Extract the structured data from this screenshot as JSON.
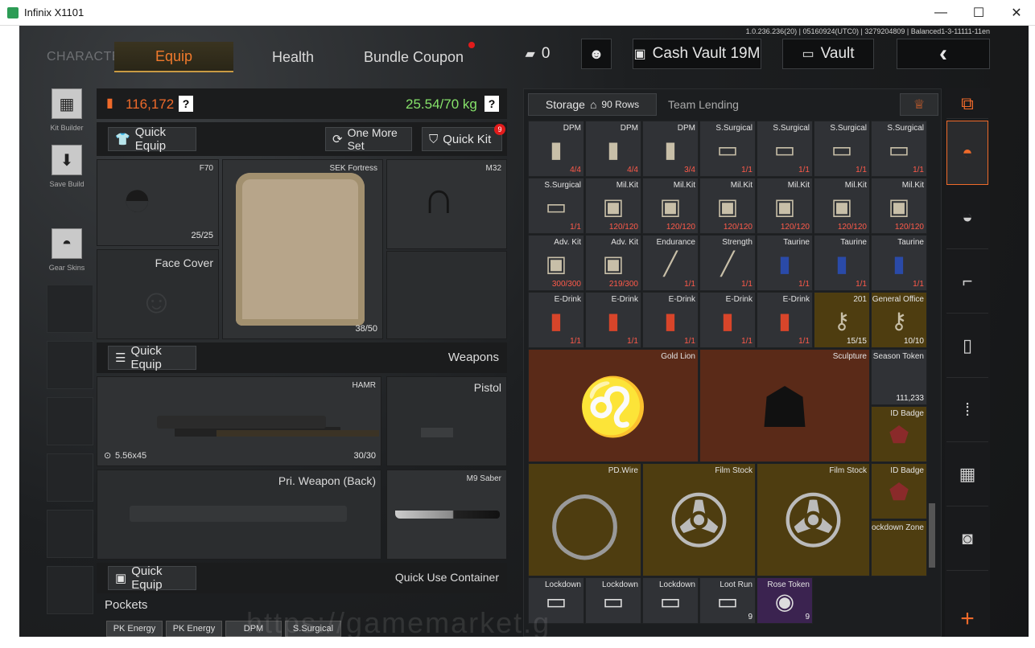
{
  "window": {
    "title": "Infinix X1101",
    "min": "—",
    "max": "☐",
    "close": "✕"
  },
  "version": "1.0.236.236(20) | 05160924(UTC0) | 3279204809 | Balanced1-3-11111-11en",
  "nav": {
    "character": "CHARACTER",
    "tabs": [
      "Equip",
      "Health",
      "Bundle Coupon"
    ],
    "cash_count": "0",
    "cash_vault": "Cash Vault 19M",
    "vault": "Vault"
  },
  "sidebar": {
    "kit_builder": "Kit Builder",
    "save_build": "Save Build",
    "gear_skins": "Gear Skins"
  },
  "loadout": {
    "value": "116,172",
    "weight": "25.54/70 kg",
    "quick_equip": "Quick Equip",
    "one_more_set": "One More Set",
    "quick_kit": "Quick Kit",
    "quick_kit_badge": "9",
    "helmet_name": "F70",
    "helmet_dur": "25/25",
    "armor_name": "SEK Fortress",
    "armor_dur": "38/50",
    "headset_name": "M32",
    "face_cover": "Face Cover",
    "weapons_quick": "Quick Equip",
    "weapons": "Weapons",
    "primary_name": "HAMR",
    "primary_ammo": "5.56x45",
    "primary_count": "30/30",
    "pistol": "Pistol",
    "pri_back": "Pri. Weapon (Back)",
    "melee": "M9 Saber",
    "container_quick": "Quick Equip",
    "quick_use": "Quick Use Container",
    "pockets": "Pockets",
    "pocket_items": [
      "PK Energy",
      "PK Energy",
      "DPM",
      "S.Surgical"
    ]
  },
  "storage": {
    "tab": "Storage",
    "rows": "90 Rows",
    "team_lending": "Team Lending",
    "cells": [
      {
        "n": "DPM",
        "c": "4/4",
        "r": 0,
        "col": 0
      },
      {
        "n": "DPM",
        "c": "4/4",
        "r": 0,
        "col": 1
      },
      {
        "n": "DPM",
        "c": "3/4",
        "r": 0,
        "col": 2
      },
      {
        "n": "S.Surgical",
        "c": "1/1",
        "r": 0,
        "col": 3
      },
      {
        "n": "S.Surgical",
        "c": "1/1",
        "r": 0,
        "col": 4
      },
      {
        "n": "S.Surgical",
        "c": "1/1",
        "r": 0,
        "col": 5
      },
      {
        "n": "S.Surgical",
        "c": "1/1",
        "r": 0,
        "col": 6
      },
      {
        "n": "S.Surgical",
        "c": "1/1",
        "r": 1,
        "col": 0
      },
      {
        "n": "Mil.Kit",
        "c": "120/120",
        "r": 1,
        "col": 1
      },
      {
        "n": "Mil.Kit",
        "c": "120/120",
        "r": 1,
        "col": 2
      },
      {
        "n": "Mil.Kit",
        "c": "120/120",
        "r": 1,
        "col": 3
      },
      {
        "n": "Mil.Kit",
        "c": "120/120",
        "r": 1,
        "col": 4
      },
      {
        "n": "Mil.Kit",
        "c": "120/120",
        "r": 1,
        "col": 5
      },
      {
        "n": "Mil.Kit",
        "c": "120/120",
        "r": 1,
        "col": 6
      },
      {
        "n": "Adv. Kit",
        "c": "300/300",
        "r": 2,
        "col": 0
      },
      {
        "n": "Adv. Kit",
        "c": "219/300",
        "r": 2,
        "col": 1
      },
      {
        "n": "Endurance",
        "c": "1/1",
        "r": 2,
        "col": 2
      },
      {
        "n": "Strength",
        "c": "1/1",
        "r": 2,
        "col": 3
      },
      {
        "n": "Taurine",
        "c": "1/1",
        "r": 2,
        "col": 4
      },
      {
        "n": "Taurine",
        "c": "1/1",
        "r": 2,
        "col": 5
      },
      {
        "n": "Taurine",
        "c": "1/1",
        "r": 2,
        "col": 6
      },
      {
        "n": "E-Drink",
        "c": "1/1",
        "r": 3,
        "col": 0
      },
      {
        "n": "E-Drink",
        "c": "1/1",
        "r": 3,
        "col": 1
      },
      {
        "n": "E-Drink",
        "c": "1/1",
        "r": 3,
        "col": 2
      },
      {
        "n": "E-Drink",
        "c": "1/1",
        "r": 3,
        "col": 3
      },
      {
        "n": "E-Drink",
        "c": "1/1",
        "r": 3,
        "col": 4
      },
      {
        "n": "201",
        "c": "15/15",
        "r": 3,
        "col": 5
      },
      {
        "n": "General Office",
        "c": "10/10",
        "r": 3,
        "col": 6
      }
    ],
    "gold_lion": "Gold Lion",
    "sculpture": "Sculpture",
    "season_token": "Season Token",
    "season_count": "111,233",
    "id_badge": "ID Badge",
    "pd_wire": "PD.Wire",
    "film_stock": "Film Stock",
    "lockdown_zone": "Lockdown Zone",
    "bottom": [
      {
        "n": "Lockdown",
        "c": ""
      },
      {
        "n": "Lockdown",
        "c": ""
      },
      {
        "n": "Lockdown",
        "c": ""
      },
      {
        "n": "Loot Run",
        "c": "9"
      },
      {
        "n": "Rose Token",
        "c": "9"
      }
    ]
  },
  "watermark": "https://gamemarket.g"
}
